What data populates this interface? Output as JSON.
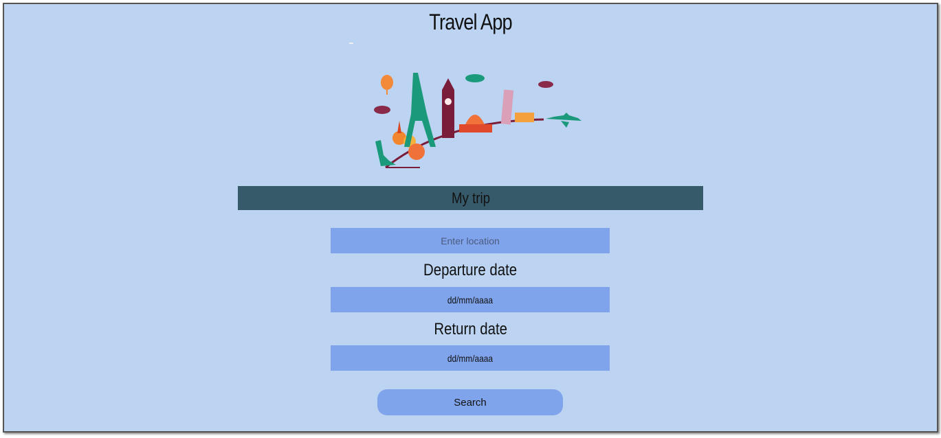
{
  "header": {
    "title": "Travel App"
  },
  "hero": {
    "icon": "travel-landmarks-illustration"
  },
  "trip": {
    "section_title": "My trip",
    "location_placeholder": "Enter location",
    "departure_label": "Departure date",
    "departure_value": "dd/mm/aaaa",
    "return_label": "Return date",
    "return_value": "dd/mm/aaaa",
    "search_label": "Search"
  },
  "colors": {
    "background": "#bcd3f2",
    "header_bar": "#375a6b",
    "field": "#80a4eb"
  }
}
